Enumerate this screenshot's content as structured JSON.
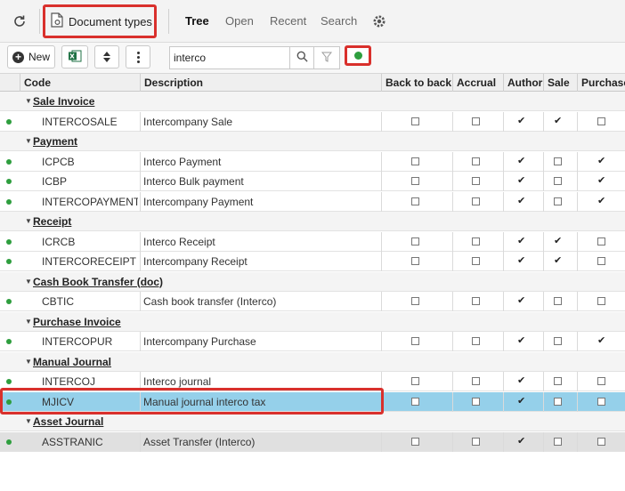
{
  "header": {
    "doc_types_label": "Document types",
    "tabs": [
      {
        "label": "Tree",
        "active": true
      },
      {
        "label": "Open",
        "active": false
      },
      {
        "label": "Recent",
        "active": false
      },
      {
        "label": "Search",
        "active": false
      }
    ]
  },
  "toolbar": {
    "new_label": "New",
    "search_value": "interco"
  },
  "grid": {
    "columns": [
      "Code",
      "Description",
      "Back to back",
      "Accrual",
      "Author",
      "Sale",
      "Purchase"
    ],
    "rows": [
      {
        "type": "group",
        "label": "Sale Invoice"
      },
      {
        "type": "item",
        "code": "INTERCOSALE",
        "desc": "Intercompany Sale",
        "flags": [
          0,
          0,
          1,
          1,
          0
        ]
      },
      {
        "type": "group",
        "label": "Payment"
      },
      {
        "type": "item",
        "code": "ICPCB",
        "desc": "Interco Payment",
        "flags": [
          0,
          0,
          1,
          0,
          1
        ]
      },
      {
        "type": "item",
        "code": "ICBP",
        "desc": "Interco Bulk payment",
        "flags": [
          0,
          0,
          1,
          0,
          1
        ]
      },
      {
        "type": "item",
        "code": "INTERCOPAYMENT",
        "desc": "Intercompany Payment",
        "flags": [
          0,
          0,
          1,
          0,
          1
        ]
      },
      {
        "type": "group",
        "label": "Receipt"
      },
      {
        "type": "item",
        "code": "ICRCB",
        "desc": "Interco Receipt",
        "flags": [
          0,
          0,
          1,
          1,
          0
        ]
      },
      {
        "type": "item",
        "code": "INTERCORECEIPT",
        "desc": "Intercompany Receipt",
        "flags": [
          0,
          0,
          1,
          1,
          0
        ]
      },
      {
        "type": "group",
        "label": "Cash Book Transfer (doc)"
      },
      {
        "type": "item",
        "code": "CBTIC",
        "desc": "Cash book transfer (Interco)",
        "flags": [
          0,
          0,
          1,
          0,
          0
        ]
      },
      {
        "type": "group",
        "label": "Purchase Invoice"
      },
      {
        "type": "item",
        "code": "INTERCOPUR",
        "desc": "Intercompany Purchase",
        "flags": [
          0,
          0,
          1,
          0,
          1
        ]
      },
      {
        "type": "group",
        "label": "Manual Journal"
      },
      {
        "type": "item",
        "code": "INTERCOJ",
        "desc": "Interco journal",
        "flags": [
          0,
          0,
          1,
          0,
          0
        ]
      },
      {
        "type": "item",
        "code": "MJICV",
        "desc": "Manual journal interco tax",
        "flags": [
          0,
          0,
          1,
          0,
          0
        ],
        "selected": true
      },
      {
        "type": "group",
        "label": "Asset Journal"
      },
      {
        "type": "item",
        "code": "ASSTRANIC",
        "desc": "Asset Transfer (Interco)",
        "flags": [
          0,
          0,
          1,
          0,
          0
        ],
        "shaded": true
      }
    ]
  },
  "colors": {
    "accent_red": "#d9302c",
    "active_green": "#2e9e3e",
    "selected_row": "#95d0ea"
  }
}
